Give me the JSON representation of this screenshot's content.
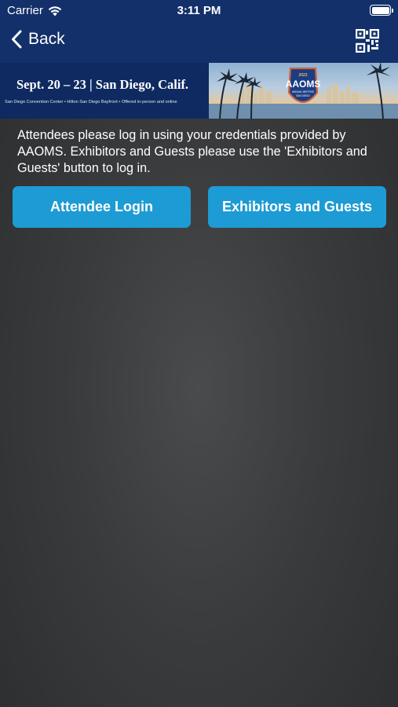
{
  "status_bar": {
    "carrier": "Carrier",
    "time": "3:11 PM",
    "icons": [
      "wifi-icon",
      "battery-icon"
    ]
  },
  "nav": {
    "back_label": "Back",
    "qr_icon": "qr-code-icon",
    "background": "#13306a"
  },
  "banner": {
    "dates": "Sept. 20 – 23 | San Diego, Calif.",
    "subtitle": "San Diego Convention Center • Hilton San Diego Bayfront • Offered in-person and online",
    "logo_year": "2023",
    "logo_name": "AAOMS",
    "logo_tagline": "ANNUAL MEETING",
    "logo_city": "SAN DIEGO"
  },
  "content": {
    "intro": "Attendees please log in using your credentials provided by AAOMS. Exhibitors and Guests please use the 'Exhibitors and Guests' button to log in.",
    "attendee_button": "Attendee Login",
    "exhibitor_button": "Exhibitors and Guests",
    "button_color": "#1d9bd4"
  }
}
